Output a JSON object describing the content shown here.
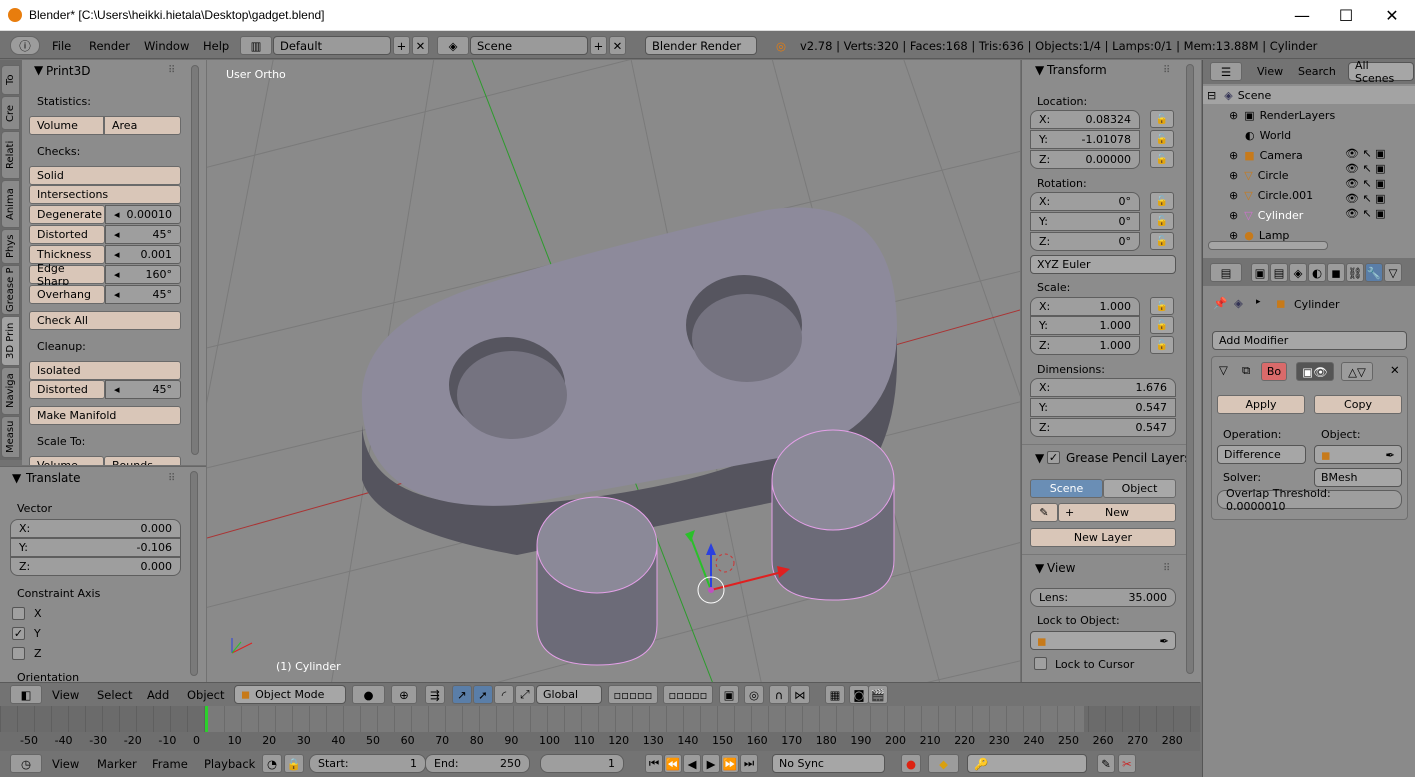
{
  "window": {
    "title": "Blender* [C:\\Users\\heikki.hietala\\Desktop\\gadget.blend]",
    "min": "—",
    "max": "☐",
    "close": "✕"
  },
  "info": {
    "menus": [
      "File",
      "Render",
      "Window",
      "Help"
    ],
    "screen": "Default",
    "scene": "Scene",
    "engine": "Blender Render",
    "stats": "v2.78 | Verts:320 | Faces:168 | Tris:636 | Objects:1/4 | Lamps:0/1 | Mem:13.88M | Cylinder"
  },
  "tabs": [
    "To",
    "Cre",
    "Relati",
    "Anima",
    "Phys",
    "Grease P",
    "3D Prin",
    "Naviga",
    "Measu"
  ],
  "print3d": {
    "title": "Print3D",
    "statistics": "Statistics:",
    "volume": "Volume",
    "area": "Area",
    "checks": "Checks:",
    "solid": "Solid",
    "intersections": "Intersections",
    "rows": [
      {
        "label": "Degenerate",
        "value": "0.00010"
      },
      {
        "label": "Distorted",
        "value": "45°"
      },
      {
        "label": "Thickness",
        "value": "0.001"
      },
      {
        "label": "Edge Sharp",
        "value": "160°"
      },
      {
        "label": "Overhang",
        "value": "45°"
      }
    ],
    "check_all": "Check All",
    "cleanup": "Cleanup:",
    "isolated": "Isolated",
    "distorted": "Distorted",
    "distorted_val": "45°",
    "make_manifold": "Make Manifold",
    "scale_to": "Scale To:",
    "scale_volume": "Volume",
    "scale_bounds": "Bounds"
  },
  "translate": {
    "title": "Translate",
    "vector": "Vector",
    "x": "X:",
    "xv": "0.000",
    "y": "Y:",
    "yv": "-0.106",
    "z": "Z:",
    "zv": "0.000",
    "constraint": "Constraint Axis",
    "cx": "X",
    "cy": "Y",
    "cz": "Z",
    "orientation": "Orientation"
  },
  "viewport": {
    "label": "User Ortho",
    "object": "(1) Cylinder"
  },
  "transform": {
    "title": "Transform",
    "location": "Location:",
    "loc": [
      {
        "a": "X:",
        "v": "0.08324"
      },
      {
        "a": "Y:",
        "v": "-1.01078"
      },
      {
        "a": "Z:",
        "v": "0.00000"
      }
    ],
    "rotation": "Rotation:",
    "rot": [
      {
        "a": "X:",
        "v": "0°"
      },
      {
        "a": "Y:",
        "v": "0°"
      },
      {
        "a": "Z:",
        "v": "0°"
      }
    ],
    "euler": "XYZ Euler",
    "scale": "Scale:",
    "scl": [
      {
        "a": "X:",
        "v": "1.000"
      },
      {
        "a": "Y:",
        "v": "1.000"
      },
      {
        "a": "Z:",
        "v": "1.000"
      }
    ],
    "dimensions": "Dimensions:",
    "dim": [
      {
        "a": "X:",
        "v": "1.676"
      },
      {
        "a": "Y:",
        "v": "0.547"
      },
      {
        "a": "Z:",
        "v": "0.547"
      }
    ]
  },
  "grease": {
    "title": "Grease Pencil Layers",
    "scene": "Scene",
    "object": "Object",
    "new": "New",
    "new_layer": "New Layer"
  },
  "view": {
    "title": "View",
    "lens_label": "Lens:",
    "lens": "35.000",
    "lock_obj": "Lock to Object:",
    "lock_cursor": "Lock to Cursor"
  },
  "outliner": {
    "view": "View",
    "search": "Search",
    "all_scenes": "All Scenes",
    "items": [
      "Scene",
      "RenderLayers",
      "World",
      "Camera",
      "Circle",
      "Circle.001",
      "Cylinder",
      "Lamp"
    ]
  },
  "props": {
    "object": "Cylinder",
    "add_modifier": "Add Modifier",
    "mod_name": "Bo",
    "apply": "Apply",
    "copy": "Copy",
    "operation_label": "Operation:",
    "operation": "Difference",
    "object_label": "Object:",
    "solver_label": "Solver:",
    "solver": "BMesh",
    "overlap": "Overlap Threshold: 0.0000010"
  },
  "viewheader": {
    "menus": [
      "View",
      "Select",
      "Add",
      "Object"
    ],
    "mode": "Object Mode",
    "orientation": "Global"
  },
  "timeline": {
    "ticks": [
      "-50",
      "-40",
      "-30",
      "-20",
      "-10",
      "0",
      "10",
      "20",
      "30",
      "40",
      "50",
      "60",
      "70",
      "80",
      "90",
      "100",
      "110",
      "120",
      "130",
      "140",
      "150",
      "160",
      "170",
      "180",
      "190",
      "200",
      "210",
      "220",
      "230",
      "240",
      "250",
      "260",
      "270",
      "280"
    ]
  },
  "bottom": {
    "menus": [
      "View",
      "Marker",
      "Frame",
      "Playback"
    ],
    "start": "Start:",
    "start_v": "1",
    "end": "End:",
    "end_v": "250",
    "current": "1",
    "sync": "No Sync"
  }
}
